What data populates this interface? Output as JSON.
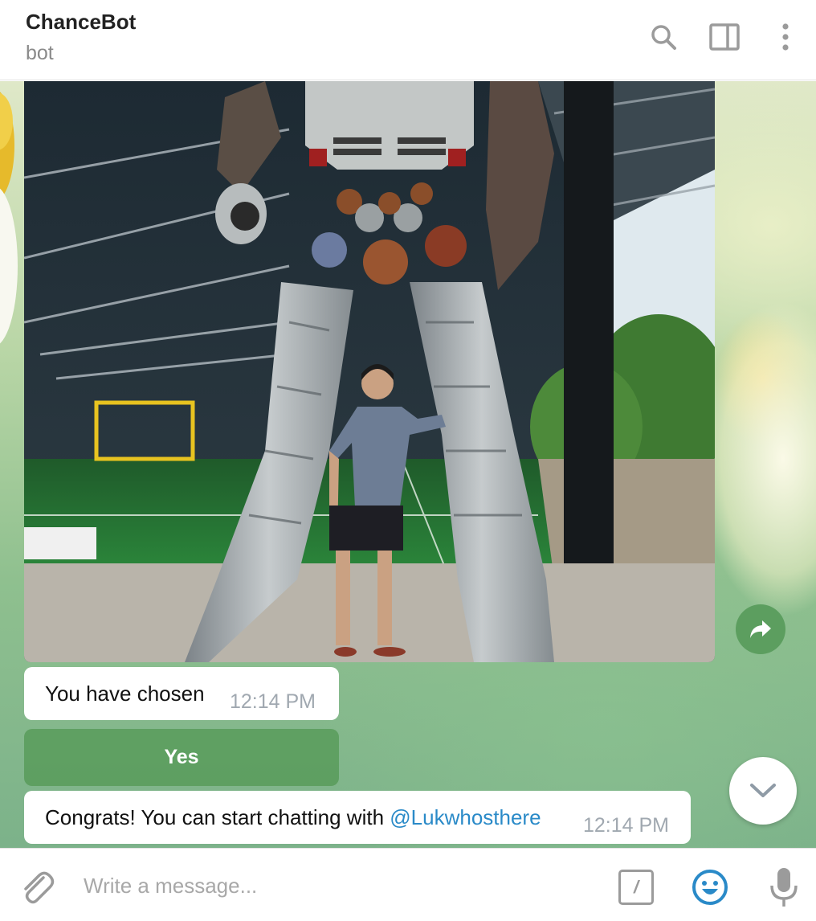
{
  "header": {
    "title": "ChanceBot",
    "subtitle": "bot",
    "icons": [
      "search-icon",
      "sidebar-toggle-icon",
      "more-vertical-icon"
    ]
  },
  "photo": {
    "alt": "Man standing under a giant robot statue"
  },
  "messages": [
    {
      "text": "You have chosen",
      "time": "12:14 PM"
    },
    {
      "text": "Congrats! You can start chatting with ",
      "mention": "@Lukwhosthere",
      "time": "12:14 PM"
    }
  ],
  "bot_button": {
    "label": "Yes"
  },
  "compose": {
    "placeholder": "Write a message...",
    "command_glyph": "/"
  },
  "colors": {
    "accent": "#2a8ac8",
    "bot_button": "#5b9a5c",
    "forward_button": "#5c9e5f"
  }
}
